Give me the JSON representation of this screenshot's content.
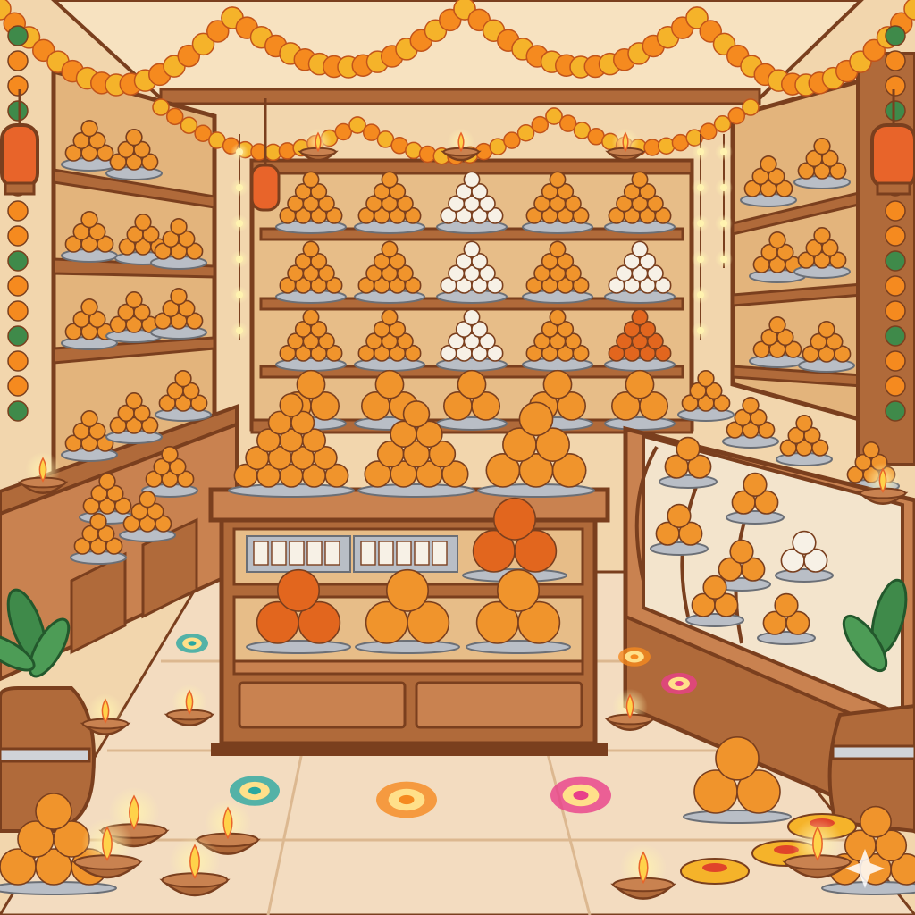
{
  "scene": {
    "palette": {
      "wall": "#f2d6ad",
      "wood": "#b06a3a",
      "wood_dark": "#7a3f1e",
      "wood_light": "#c98250",
      "floor": "#f3dcc0",
      "tray": "#b9bec6",
      "laddu": "#f0942c",
      "laddu_dark": "#e2661e",
      "white_sweet": "#f7f1e6",
      "marigold": "#f58a1f",
      "marigold_yellow": "#f5b32a",
      "flame": "#ffd24a",
      "leaf": "#3f8a4a",
      "lantern": "#e8642a"
    },
    "icons": [
      "marigold-garland",
      "diya-lamp",
      "hanging-lantern",
      "rangoli",
      "clay-pot",
      "mango-leaves",
      "sparkle"
    ]
  }
}
